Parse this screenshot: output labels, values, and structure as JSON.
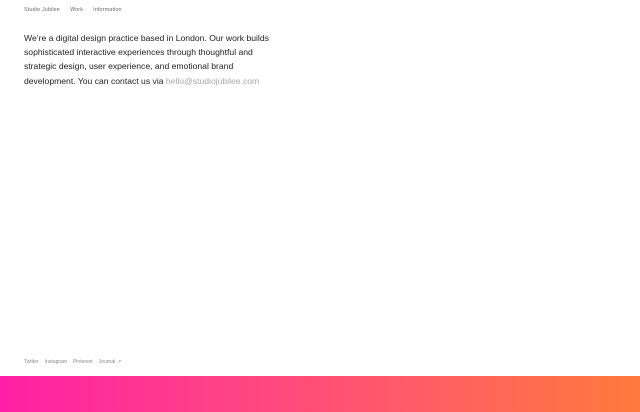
{
  "nav": {
    "items": [
      {
        "label": "Studio Jubilee"
      },
      {
        "label": "Work"
      },
      {
        "label": "Information"
      }
    ]
  },
  "intro": {
    "text": "We’re a digital design practice based in London. Our work builds sophisticated interactive experiences through thoughtful and strategic design, user experience, and emotional brand development. You can contact us via",
    "email": "hello@studiojubilee.com"
  },
  "footer": {
    "links": [
      {
        "label": "Twitter"
      },
      {
        "label": "Instagram"
      },
      {
        "label": "Pinterest"
      },
      {
        "label": "Journal"
      }
    ],
    "journal_arrow": "↗"
  },
  "colors": {
    "gradient_start": "#ff1fa6",
    "gradient_mid": "#ff5f63",
    "gradient_end": "#ff7a3b",
    "link_gray": "#a7a7a7"
  }
}
